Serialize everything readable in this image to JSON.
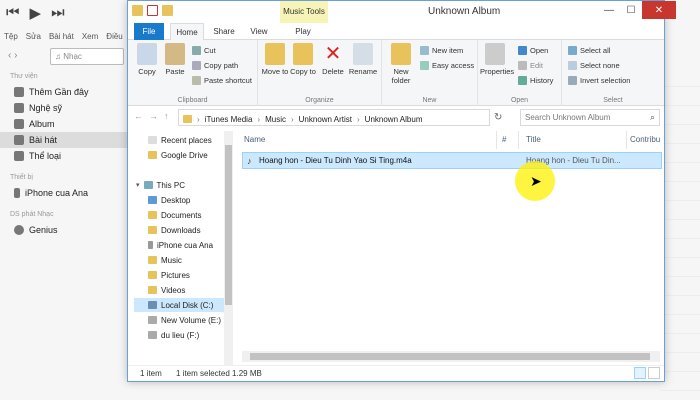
{
  "itunes": {
    "menu": [
      "Tệp",
      "Sửa",
      "Bài hát",
      "Xem",
      "Điều"
    ],
    "search_placeholder": "Nhạc",
    "sections": [
      {
        "heading": "Thư viện",
        "items": [
          {
            "label": "Thêm Gần đây",
            "icon": "recent-icon"
          },
          {
            "label": "Nghệ sỹ",
            "icon": "artist-icon"
          },
          {
            "label": "Album",
            "icon": "album-icon"
          },
          {
            "label": "Bài hát",
            "icon": "song-icon",
            "selected": true
          },
          {
            "label": "Thể loại",
            "icon": "genre-icon"
          }
        ]
      },
      {
        "heading": "Thiết bị",
        "items": [
          {
            "label": "iPhone cua Ana",
            "icon": "iphone-icon"
          }
        ]
      },
      {
        "heading": "DS phát Nhạc",
        "items": [
          {
            "label": "Genius",
            "icon": "genius-icon"
          }
        ]
      }
    ]
  },
  "explorer": {
    "title": "Unknown Album",
    "tools_badge": "Music Tools",
    "tabs": [
      "File",
      "Home",
      "Share",
      "View",
      "Play"
    ],
    "ribbon": {
      "clipboard": {
        "label": "Clipboard",
        "copy": "Copy",
        "paste": "Paste",
        "cut": "Cut",
        "copy_path": "Copy path",
        "paste_shortcut": "Paste shortcut"
      },
      "organize": {
        "label": "Organize",
        "move_to": "Move to",
        "copy_to": "Copy to",
        "delete": "Delete",
        "rename": "Rename"
      },
      "new": {
        "label": "New",
        "new_folder": "New folder",
        "new_item": "New item",
        "easy_access": "Easy access"
      },
      "open": {
        "label": "Open",
        "properties": "Properties",
        "open": "Open",
        "edit": "Edit",
        "history": "History"
      },
      "select": {
        "label": "Select",
        "select_all": "Select all",
        "select_none": "Select none",
        "invert": "Invert selection"
      }
    },
    "address": [
      "iTunes Media",
      "Music",
      "Unknown Artist",
      "Unknown Album"
    ],
    "search_placeholder": "Search Unknown Album",
    "nav": [
      {
        "label": "Recent places",
        "indent": 1
      },
      {
        "label": "Google Drive",
        "indent": 1
      },
      {
        "label": "This PC",
        "indent": 0
      },
      {
        "label": "Desktop",
        "indent": 1
      },
      {
        "label": "Documents",
        "indent": 1
      },
      {
        "label": "Downloads",
        "indent": 1
      },
      {
        "label": "iPhone cua Ana",
        "indent": 1
      },
      {
        "label": "Music",
        "indent": 1
      },
      {
        "label": "Pictures",
        "indent": 1
      },
      {
        "label": "Videos",
        "indent": 1
      },
      {
        "label": "Local Disk (C:)",
        "indent": 1,
        "selected": true
      },
      {
        "label": "New Volume (E:)",
        "indent": 1
      },
      {
        "label": "du lieu (F:)",
        "indent": 1
      }
    ],
    "columns": {
      "name": "Name",
      "number": "#",
      "title": "Title",
      "contributing": "Contribu"
    },
    "files": [
      {
        "name": "Hoang hon - Dieu Tu Dinh Yao Si Ting.m4a",
        "title": "Hoang hon - Dieu Tu Din..."
      }
    ],
    "status": {
      "count": "1 item",
      "selected": "1 item selected  1.29 MB"
    }
  }
}
